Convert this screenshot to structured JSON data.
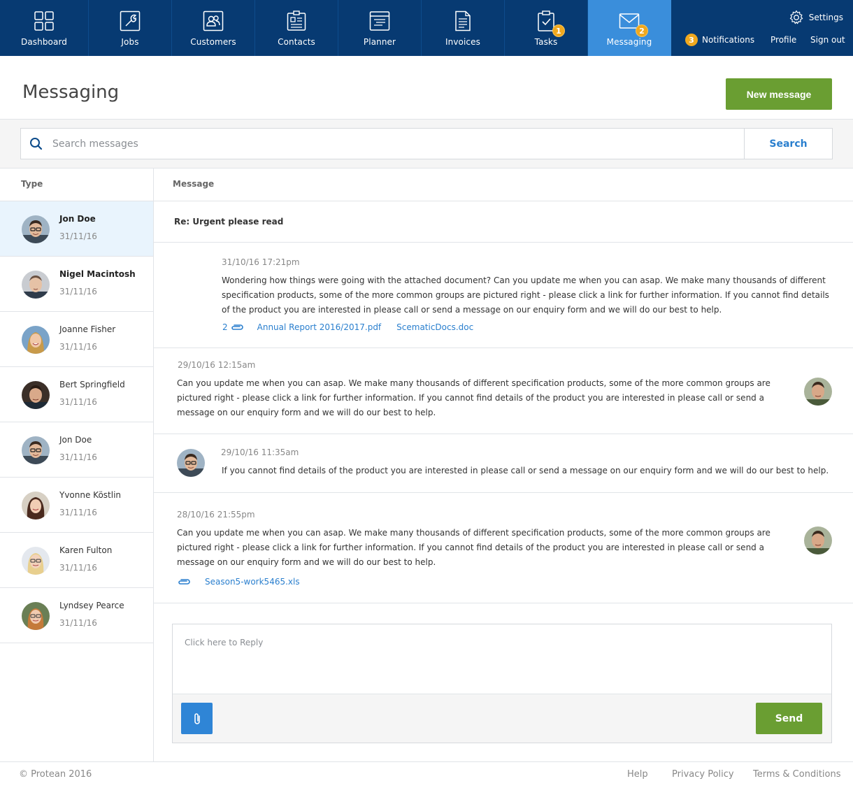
{
  "nav": {
    "items": [
      {
        "label": "Dashboard",
        "icon": "dashboard-grid-icon"
      },
      {
        "label": "Jobs",
        "icon": "wrench-icon"
      },
      {
        "label": "Customers",
        "icon": "customers-icon"
      },
      {
        "label": "Contacts",
        "icon": "contacts-card-icon"
      },
      {
        "label": "Planner",
        "icon": "planner-icon"
      },
      {
        "label": "Invoices",
        "icon": "invoice-icon"
      },
      {
        "label": "Tasks",
        "icon": "clipboard-check-icon",
        "badge": "1"
      },
      {
        "label": "Messaging",
        "icon": "envelope-icon",
        "badge": "2",
        "active": true
      }
    ],
    "settings_label": "Settings",
    "notifications_label": "Notifications",
    "notifications_count": "3",
    "profile_label": "Profile",
    "signout_label": "Sign out"
  },
  "page": {
    "title": "Messaging",
    "new_message_label": "New message"
  },
  "search": {
    "placeholder": "Search messages",
    "button_label": "Search"
  },
  "list": {
    "header": "Type",
    "contacts": [
      {
        "name": "Jon Doe",
        "date": "31/11/16",
        "selected": true,
        "unread": true
      },
      {
        "name": "Nigel Macintosh",
        "date": "31/11/16",
        "unread": true
      },
      {
        "name": "Joanne Fisher",
        "date": "31/11/16"
      },
      {
        "name": "Bert Springfield",
        "date": "31/11/16"
      },
      {
        "name": "Jon Doe",
        "date": "31/11/16"
      },
      {
        "name": "Yvonne Köstlin",
        "date": "31/11/16"
      },
      {
        "name": "Karen Fulton",
        "date": "31/11/16"
      },
      {
        "name": "Lyndsey Pearce",
        "date": "31/11/16"
      }
    ]
  },
  "thread": {
    "header": "Message",
    "subject": "Re: Urgent please read",
    "messages": [
      {
        "date": "31/10/16  17:21pm",
        "text": "Wondering how things were going with the attached document? Can you update me when you can asap. We make many thousands of different specification products, some of the more common groups are pictured right - please click a link for further information. If you cannot find details of the product you are interested in please call or send a message on our enquiry form and we will do our best to help.",
        "attachment_count": "2",
        "attachments": [
          "Annual Report 2016/2017.pdf",
          "ScematicDocs.doc"
        ]
      },
      {
        "date": "29/10/16  12:15am",
        "text": "Can you update me when you can asap. We make many thousands of different specification products, some of the more common groups are pictured right - please click a link for further information. If you cannot find details of the product you are interested in please call or send a message on our enquiry form and we will do our best to help."
      },
      {
        "date": "29/10/16  11:35am",
        "text": "If you cannot find details of the product you are interested in please call or send a message on our enquiry form and we will do our best to help."
      },
      {
        "date": "28/10/16  21:55pm",
        "text": "Can you update me when you can asap. We make many thousands of different specification products, some of the more common groups are pictured right - please click a link for further information. If you cannot find details of the product you are interested in please call or send a message on our enquiry form and we will do our best to help.",
        "attachments": [
          "Season5-work5465.xls"
        ]
      }
    ]
  },
  "reply": {
    "placeholder": "Click here to Reply",
    "send_label": "Send"
  },
  "footer": {
    "copyright": "© Protean 2016",
    "links": [
      "Help",
      "Privacy Policy",
      "Terms & Conditions"
    ]
  },
  "colors": {
    "nav_bg": "#073a72",
    "nav_active": "#3a8edb",
    "badge": "#f0a81e",
    "primary_green": "#6a9e32",
    "link_blue": "#2a7fce"
  }
}
